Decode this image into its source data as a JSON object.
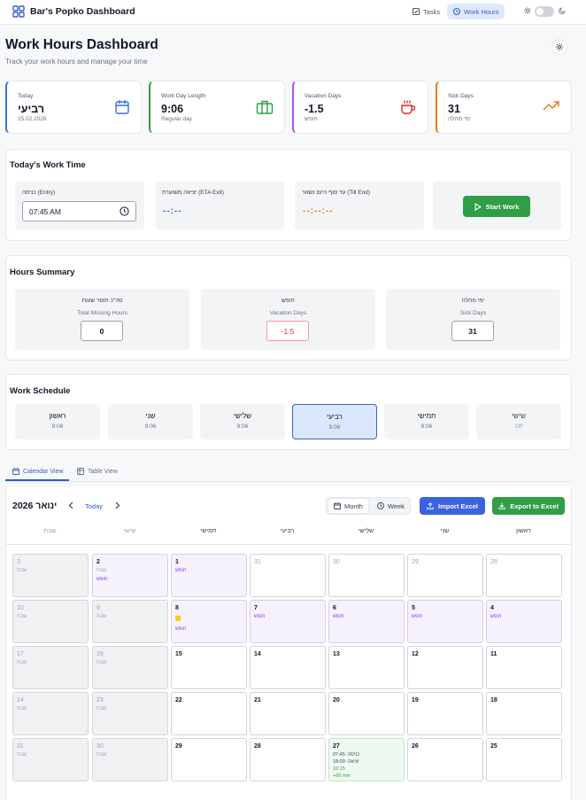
{
  "app": {
    "title": "Bar's Popko Dashboard"
  },
  "nav": {
    "tasks_label": "Tasks",
    "work_hours_label": "Work Hours"
  },
  "page": {
    "title": "Work Hours Dashboard",
    "subtitle": "Track your work hours and manage your time"
  },
  "stats": [
    {
      "label": "Today",
      "value": "רביעי",
      "sub": "25.02.2026",
      "icon": "calendar-icon",
      "color": "#3b6fd8"
    },
    {
      "label": "Work Day Length",
      "value": "9:06",
      "sub": "Regular day",
      "icon": "briefcase-icon",
      "color": "#2f9e44"
    },
    {
      "label": "Vacation Days",
      "value": "-1.5",
      "sub": "חופש",
      "icon": "coffee-icon",
      "color": "#dc2626"
    },
    {
      "label": "Sick Days",
      "value": "31",
      "sub": "ימי מחלה",
      "icon": "trending-up-icon",
      "color": "#ea7a1c"
    }
  ],
  "today_work": {
    "title": "Today's Work Time",
    "entry_label": "כניסה (Entry)",
    "entry_value": "07:45 AM",
    "eta_label": "יציאה משוערת (ETA Exit)",
    "eta_value": "--:--",
    "till_end_label": "עד סוף היום נשאר (Till End)",
    "till_end_value": "--:--:--",
    "start_label": "Start Work"
  },
  "summary": {
    "title": "Hours Summary",
    "items": [
      {
        "he": "סה\"כ חוסר שעות",
        "en": "Total Missing Hours",
        "value": "0",
        "color": "#111827"
      },
      {
        "he": "חופש",
        "en": "Vacation Days",
        "value": "-1.5",
        "color": "#dc2626"
      },
      {
        "he": "ימי מחלה",
        "en": "Sick Days",
        "value": "31",
        "color": "#111827"
      }
    ]
  },
  "schedule": {
    "title": "Work Schedule",
    "days": [
      {
        "name": "ראשון",
        "hours": "9:06"
      },
      {
        "name": "שני",
        "hours": "9:06"
      },
      {
        "name": "שלישי",
        "hours": "9:06"
      },
      {
        "name": "רביעי",
        "hours": "9:06",
        "selected": true
      },
      {
        "name": "חמישי",
        "hours": "8:06"
      },
      {
        "name": "שישי",
        "hours": "Off",
        "off": true
      }
    ]
  },
  "views": {
    "calendar_label": "Calendar View",
    "table_label": "Table View"
  },
  "calendar": {
    "month_label": "ינואר 2026",
    "today_label": "Today",
    "month_btn": "Month",
    "week_btn": "Week",
    "import_label": "Import Excel",
    "export_label": "Export to Excel",
    "import_color": "#3b63e0",
    "export_color": "#2f9e44",
    "weekdays": [
      "ראשון",
      "שני",
      "שלישי",
      "רביעי",
      "חמישי",
      "שישי",
      "שבת"
    ],
    "weeks": [
      [
        {
          "d": "28",
          "kind": "other"
        },
        {
          "d": "29",
          "kind": "other"
        },
        {
          "d": "30",
          "kind": "other"
        },
        {
          "d": "31",
          "kind": "other"
        },
        {
          "d": "1",
          "kind": "vac",
          "lines": [
            "חופש"
          ]
        },
        {
          "d": "2",
          "kind": "vac",
          "lines": [
            "שבת",
            "חופש"
          ]
        },
        {
          "d": "3",
          "kind": "we",
          "lines": [
            "שבת"
          ]
        }
      ],
      [
        {
          "d": "4",
          "kind": "vac",
          "lines": [
            "חופש"
          ]
        },
        {
          "d": "5",
          "kind": "vac",
          "lines": [
            "חופש"
          ]
        },
        {
          "d": "6",
          "kind": "vac",
          "lines": [
            "חופש"
          ]
        },
        {
          "d": "7",
          "kind": "vac",
          "lines": [
            "חופש"
          ]
        },
        {
          "d": "8",
          "kind": "vac",
          "holiday": true,
          "lines": [
            "חופש"
          ]
        },
        {
          "d": "9",
          "kind": "we",
          "lines": [
            "שבת"
          ]
        },
        {
          "d": "10",
          "kind": "we",
          "lines": [
            "שבת"
          ]
        }
      ],
      [
        {
          "d": "11",
          "kind": "normal"
        },
        {
          "d": "12",
          "kind": "normal"
        },
        {
          "d": "13",
          "kind": "normal"
        },
        {
          "d": "14",
          "kind": "normal"
        },
        {
          "d": "15",
          "kind": "normal"
        },
        {
          "d": "16",
          "kind": "we",
          "lines": [
            "שבת"
          ]
        },
        {
          "d": "17",
          "kind": "we",
          "lines": [
            "שבת"
          ]
        }
      ],
      [
        {
          "d": "18",
          "kind": "normal"
        },
        {
          "d": "19",
          "kind": "normal"
        },
        {
          "d": "20",
          "kind": "normal"
        },
        {
          "d": "21",
          "kind": "normal"
        },
        {
          "d": "22",
          "kind": "normal"
        },
        {
          "d": "23",
          "kind": "we",
          "lines": [
            "שבת"
          ]
        },
        {
          "d": "24",
          "kind": "we",
          "lines": [
            "שבת"
          ]
        }
      ],
      [
        {
          "d": "25",
          "kind": "normal"
        },
        {
          "d": "26",
          "kind": "normal"
        },
        {
          "d": "27",
          "kind": "today",
          "lines": [
            "כניסה: 07:45",
            "יציאה: 18:00",
            "10:15",
            "+69 min"
          ]
        },
        {
          "d": "28",
          "kind": "normal"
        },
        {
          "d": "29",
          "kind": "normal"
        },
        {
          "d": "30",
          "kind": "we",
          "lines": [
            "שבת"
          ]
        },
        {
          "d": "31",
          "kind": "we",
          "lines": [
            "שבת"
          ]
        }
      ]
    ]
  }
}
